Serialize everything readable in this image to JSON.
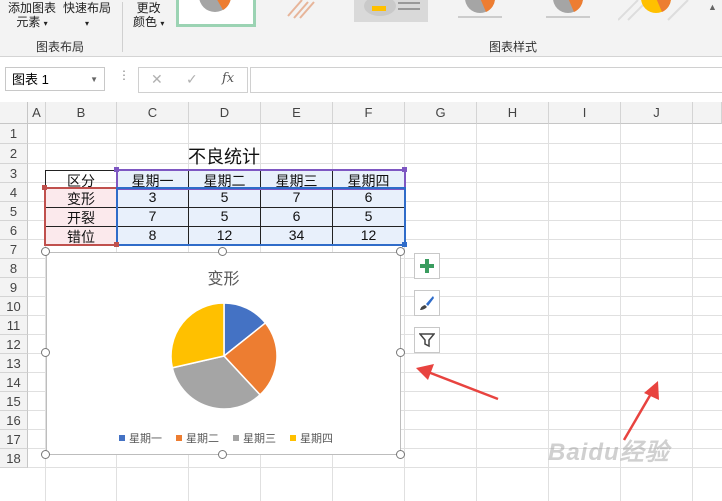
{
  "ribbon": {
    "add_element_label_1": "添加图表",
    "add_element_label_2": "元素",
    "quick_layout_label": "快速布局",
    "change_color_label_1": "更改",
    "change_color_label_2": "颜色",
    "group_chart_layout": "图表布局",
    "group_chart_styles": "图表样式"
  },
  "formula_bar": {
    "name_box": "图表 1",
    "fx_label": "fx",
    "formula_value": ""
  },
  "columns": [
    "A",
    "B",
    "C",
    "D",
    "E",
    "F",
    "G",
    "H",
    "I",
    "J"
  ],
  "rows": [
    "1",
    "2",
    "3",
    "4",
    "5",
    "6",
    "7",
    "8",
    "9",
    "10",
    "11",
    "12",
    "13",
    "14",
    "15",
    "16",
    "17",
    "18"
  ],
  "table": {
    "title": "不良统计",
    "header_label": "区分",
    "weekdays": [
      "星期一",
      "星期二",
      "星期三",
      "星期四"
    ],
    "rows": [
      {
        "label": "变形",
        "values": [
          "3",
          "5",
          "7",
          "6"
        ]
      },
      {
        "label": "开裂",
        "values": [
          "7",
          "5",
          "6",
          "5"
        ]
      },
      {
        "label": "错位",
        "values": [
          "8",
          "12",
          "34",
          "12"
        ]
      }
    ]
  },
  "chart_data": {
    "type": "pie",
    "title": "变形",
    "categories": [
      "星期一",
      "星期二",
      "星期三",
      "星期四"
    ],
    "values": [
      3,
      5,
      7,
      6
    ],
    "colors": [
      "#4472C4",
      "#ED7D31",
      "#A5A5A5",
      "#FFC000"
    ],
    "legend_position": "bottom"
  },
  "side_buttons": [
    "chart-elements",
    "chart-styles",
    "chart-filters"
  ],
  "watermark": "Baidu经验"
}
